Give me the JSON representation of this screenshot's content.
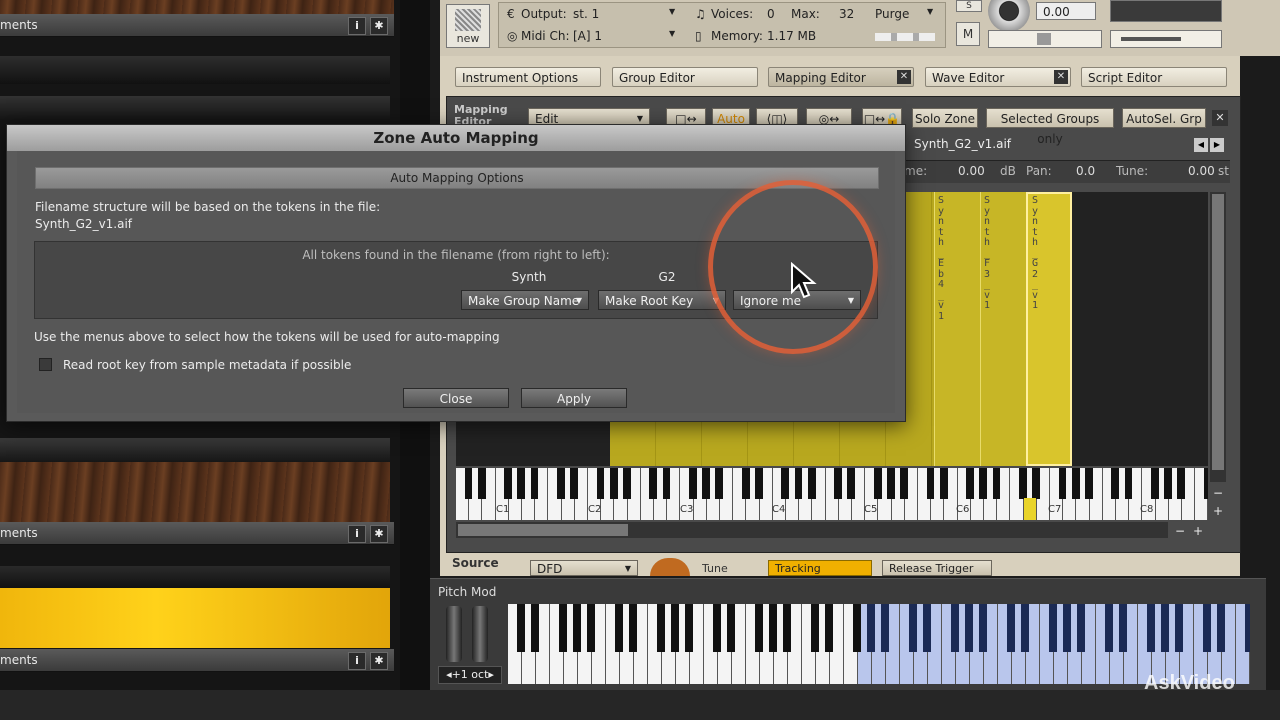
{
  "library": {
    "header_label": "ments",
    "info_icon": "i",
    "gear_icon": "✱"
  },
  "kontakt": {
    "new_label": "new",
    "output_label": "Output:",
    "output_value": "st. 1",
    "voices_label": "Voices:",
    "voices_value": "0",
    "max_label": "Max:",
    "max_value": "32",
    "purge_label": "Purge",
    "midi_label": "Midi Ch:",
    "midi_value": "[A]  1",
    "memory_label": "Memory:",
    "memory_value": "1.17 MB",
    "s_label": "S",
    "m_label": "M",
    "tune_value": "0.00",
    "tabs": [
      "Instrument Options",
      "Group Editor",
      "Mapping Editor",
      "Wave Editor",
      "Script Editor"
    ],
    "mapping_label": "Mapping\nEditor",
    "edit_menu": "Edit",
    "auto_btn": "Auto",
    "solo_zone": "Solo Zone",
    "selected_groups": "Selected Groups only",
    "autosel": "AutoSel. Grp",
    "sample_name": "Synth_G2_v1.aif",
    "vol_value": "0.00",
    "db_label": "dB",
    "pan_label": "Pan:",
    "pan_value": "0.0",
    "tune_label": "Tune:",
    "tune_field": "0.00",
    "st_label": "st",
    "zone_labels": [
      "Synth_Eb4_v1",
      "Synth_F3_v1",
      "Synth_G2_v1"
    ],
    "octave_labels": [
      "C1",
      "C2",
      "C3",
      "C4",
      "C5",
      "C6",
      "C7",
      "C8"
    ],
    "source_label": "Source",
    "dfd": "DFD",
    "tune_knob": "Tune",
    "tracking": "Tracking",
    "release": "Release Trigger",
    "pitch_mod": "Pitch Mod",
    "oct_label": "+1 oct"
  },
  "dialog": {
    "title": "Zone Auto Mapping",
    "section": "Auto Mapping Options",
    "desc_line1": "Filename structure will be based on the tokens in the file:",
    "desc_line2": "Synth_G2_v1.aif",
    "tokens_heading": "All tokens found in the filename (from right to left):",
    "tokens": [
      {
        "name": "Synth",
        "action": "Make Group Name"
      },
      {
        "name": "G2",
        "action": "Make Root Key"
      },
      {
        "name": "",
        "action": "Ignore me"
      }
    ],
    "hint": "Use the menus above to select how the tokens will be used for auto-mapping",
    "checkbox_label": "Read root key from sample metadata if possible",
    "close": "Close",
    "apply": "Apply"
  },
  "watermark": "AskVideo"
}
